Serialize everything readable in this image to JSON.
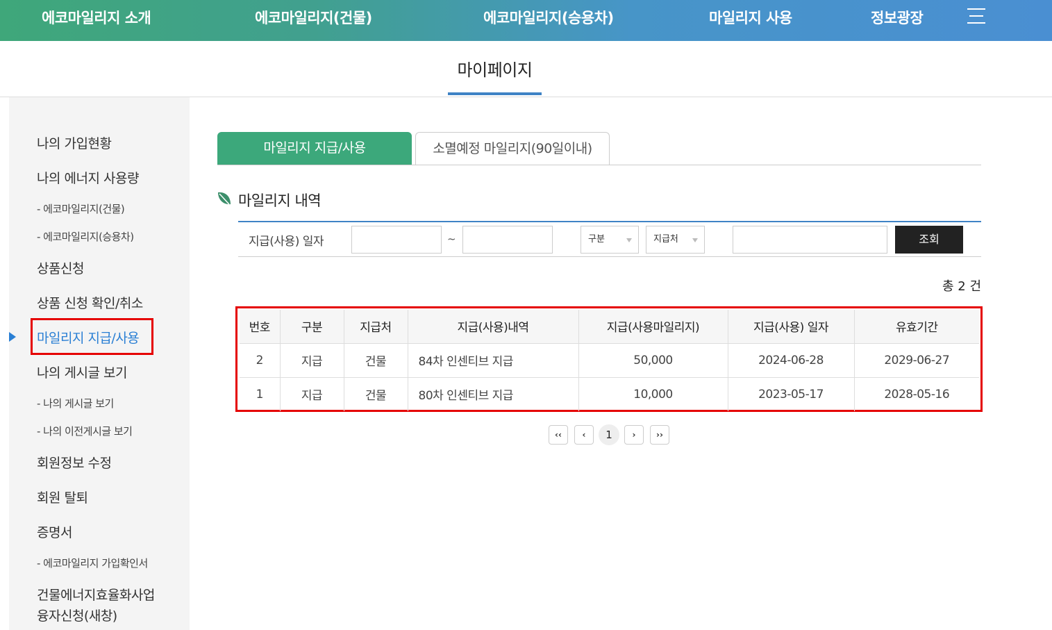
{
  "topnav": {
    "items": [
      "에코마일리지 소개",
      "에코마일리지(건물)",
      "에코마일리지(승용차)",
      "마일리지 사용",
      "정보광장"
    ]
  },
  "page_title": "마이페이지",
  "sidebar": {
    "items": [
      {
        "label": "나의 가입현황"
      },
      {
        "label": "나의 에너지 사용량"
      },
      {
        "label": "- 에코마일리지(건물)"
      },
      {
        "label": "- 에코마일리지(승용차)"
      },
      {
        "label": "상품신청"
      },
      {
        "label": "상품 신청 확인/취소"
      },
      {
        "label": "마일리지 지급/사용"
      },
      {
        "label": "나의 게시글 보기"
      },
      {
        "label": "- 나의 게시글 보기"
      },
      {
        "label": "- 나의 이전게시글 보기"
      },
      {
        "label": "회원정보 수정"
      },
      {
        "label": "회원 탈퇴"
      },
      {
        "label": "증명서"
      },
      {
        "label": "- 에코마일리지 가입확인서"
      },
      {
        "label": "건물에너지효율화사업"
      },
      {
        "label": "융자신청(새창)"
      }
    ]
  },
  "tabs": [
    "마일리지 지급/사용",
    "소멸예정 마일리지(90일이내)"
  ],
  "section_title": "마일리지 내역",
  "filter": {
    "label": "지급(사용) 일자",
    "tilde": "~",
    "select1": "구분",
    "select2": "지급처",
    "search_button": "조회"
  },
  "total": "총 2 건",
  "table": {
    "headers": [
      "번호",
      "구분",
      "지급처",
      "지급(사용)내역",
      "지급(사용마일리지)",
      "지급(사용) 일자",
      "유효기간"
    ],
    "rows": [
      [
        "2",
        "지급",
        "건물",
        "84차 인센티브 지급",
        "50,000",
        "2024-06-28",
        "2029-06-27"
      ],
      [
        "1",
        "지급",
        "건물",
        "80차 인센티브 지급",
        "10,000",
        "2023-05-17",
        "2028-05-16"
      ]
    ]
  },
  "pagination": {
    "first": "‹‹",
    "prev": "‹",
    "current": "1",
    "next": "›",
    "last": "››"
  },
  "colors": {
    "tab_active": "#3ca87b",
    "accent_blue": "#3f83c5",
    "highlight_red": "#e50000",
    "sidebar_active": "#2a7fd4"
  }
}
